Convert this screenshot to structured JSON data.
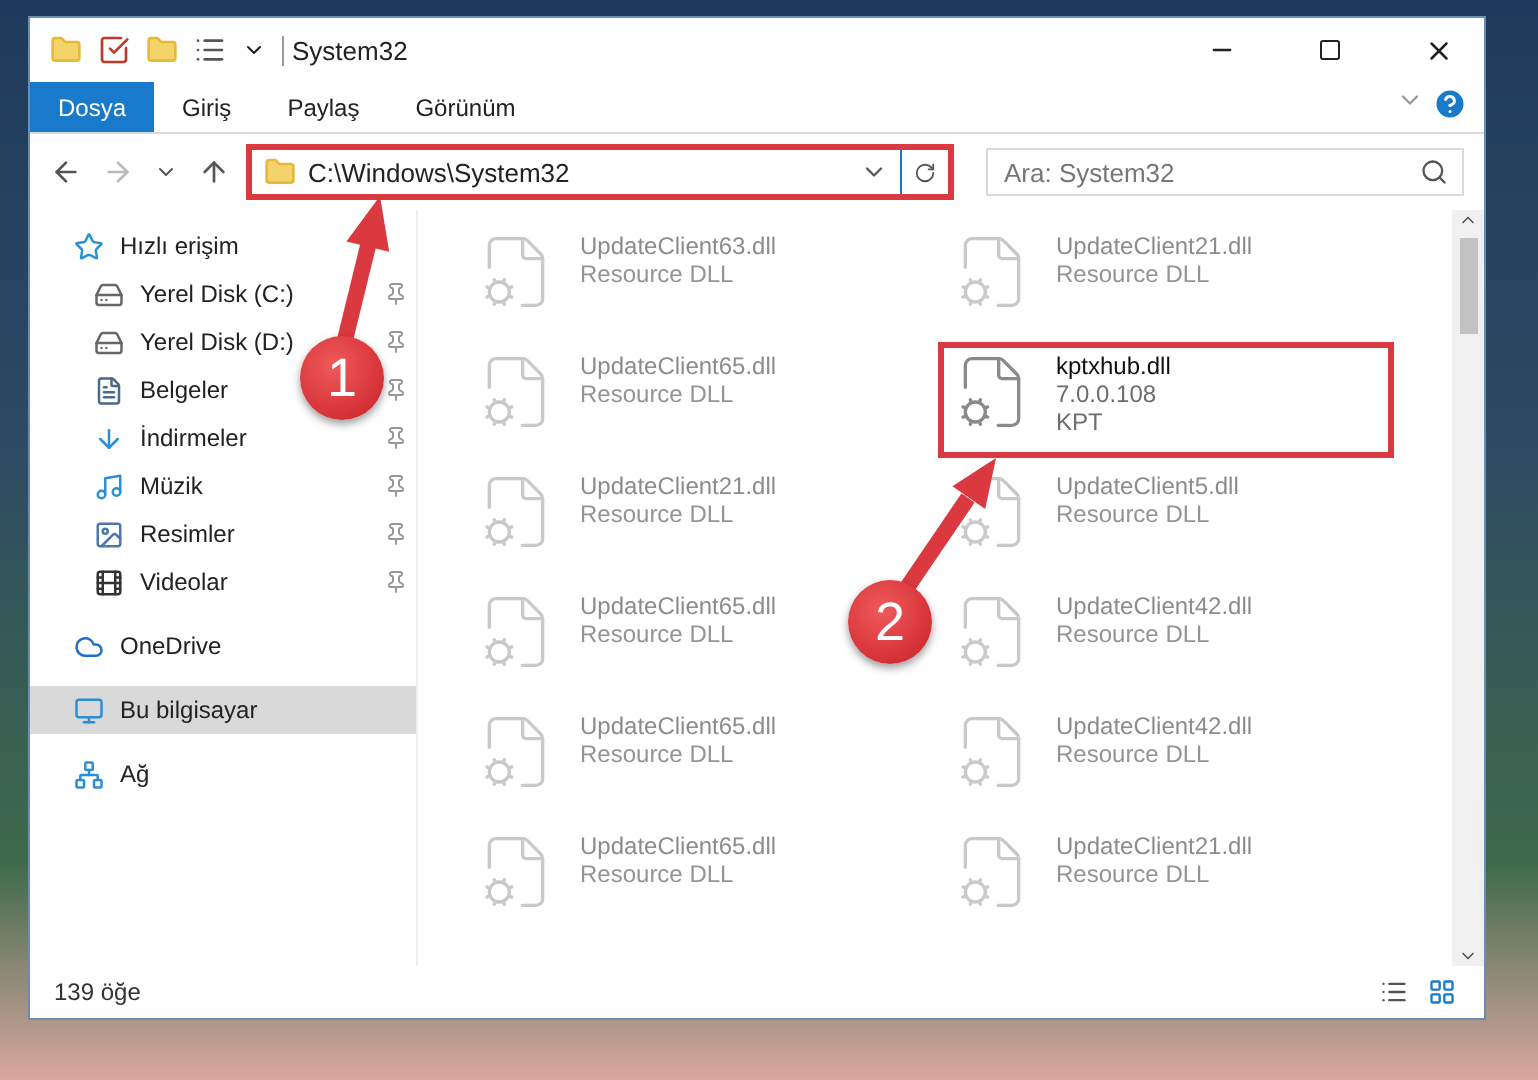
{
  "window": {
    "title": "System32"
  },
  "ribbon_tabs": [
    {
      "label": "Dosya",
      "selected": true
    },
    {
      "label": "Giriş",
      "selected": false
    },
    {
      "label": "Paylaş",
      "selected": false
    },
    {
      "label": "Görünüm",
      "selected": false
    }
  ],
  "address": {
    "value": "C:\\Windows\\System32",
    "highlighted": true
  },
  "search": {
    "placeholder": "Ara: System32"
  },
  "sidebar": {
    "items": [
      {
        "label": "Hızlı erişim",
        "selected": false,
        "children": [
          {
            "label": "Yerel Disk (C:)",
            "pinned": true,
            "selected": false
          },
          {
            "label": "Yerel Disk (D:)",
            "pinned": true,
            "selected": false
          },
          {
            "label": "Belgeler",
            "pinned": true,
            "selected": false
          },
          {
            "label": "İndirmeler",
            "pinned": true,
            "selected": false
          },
          {
            "label": "Müzik",
            "pinned": true,
            "selected": false
          },
          {
            "label": "Resimler",
            "pinned": true,
            "selected": false
          },
          {
            "label": "Videolar",
            "pinned": true,
            "selected": false
          }
        ]
      },
      {
        "label": "OneDrive",
        "selected": false
      },
      {
        "label": "Bu bilgisayar",
        "selected": true
      },
      {
        "label": "Ağ",
        "selected": false
      }
    ]
  },
  "files": [
    {
      "name": "UpdateClient63.dll",
      "lines": [
        "Resource DLL"
      ],
      "dimmed": true,
      "highlighted": false
    },
    {
      "name": "UpdateClient21.dll",
      "lines": [
        "Resource DLL"
      ],
      "dimmed": true,
      "highlighted": false
    },
    {
      "name": "UpdateClient65.dll",
      "lines": [
        "Resource DLL"
      ],
      "dimmed": true,
      "highlighted": false
    },
    {
      "name": "kptxhub.dll",
      "lines": [
        "7.0.0.108",
        "KPT"
      ],
      "dimmed": false,
      "highlighted": true
    },
    {
      "name": "UpdateClient21.dll",
      "lines": [
        "Resource DLL"
      ],
      "dimmed": true,
      "highlighted": false
    },
    {
      "name": "UpdateClient5.dll",
      "lines": [
        "Resource DLL"
      ],
      "dimmed": true,
      "highlighted": false
    },
    {
      "name": "UpdateClient65.dll",
      "lines": [
        "Resource DLL"
      ],
      "dimmed": true,
      "highlighted": false
    },
    {
      "name": "UpdateClient42.dll",
      "lines": [
        "Resource DLL"
      ],
      "dimmed": true,
      "highlighted": false
    },
    {
      "name": "UpdateClient65.dll",
      "lines": [
        "Resource DLL"
      ],
      "dimmed": true,
      "highlighted": false
    },
    {
      "name": "UpdateClient42.dll",
      "lines": [
        "Resource DLL"
      ],
      "dimmed": true,
      "highlighted": false
    },
    {
      "name": "UpdateClient65.dll",
      "lines": [
        "Resource DLL"
      ],
      "dimmed": true,
      "highlighted": false
    },
    {
      "name": "UpdateClient21.dll",
      "lines": [
        "Resource DLL"
      ],
      "dimmed": true,
      "highlighted": false
    }
  ],
  "status_bar": {
    "count": "139 öğe"
  },
  "annotations": [
    {
      "label": "1"
    },
    {
      "label": "2"
    }
  ]
}
